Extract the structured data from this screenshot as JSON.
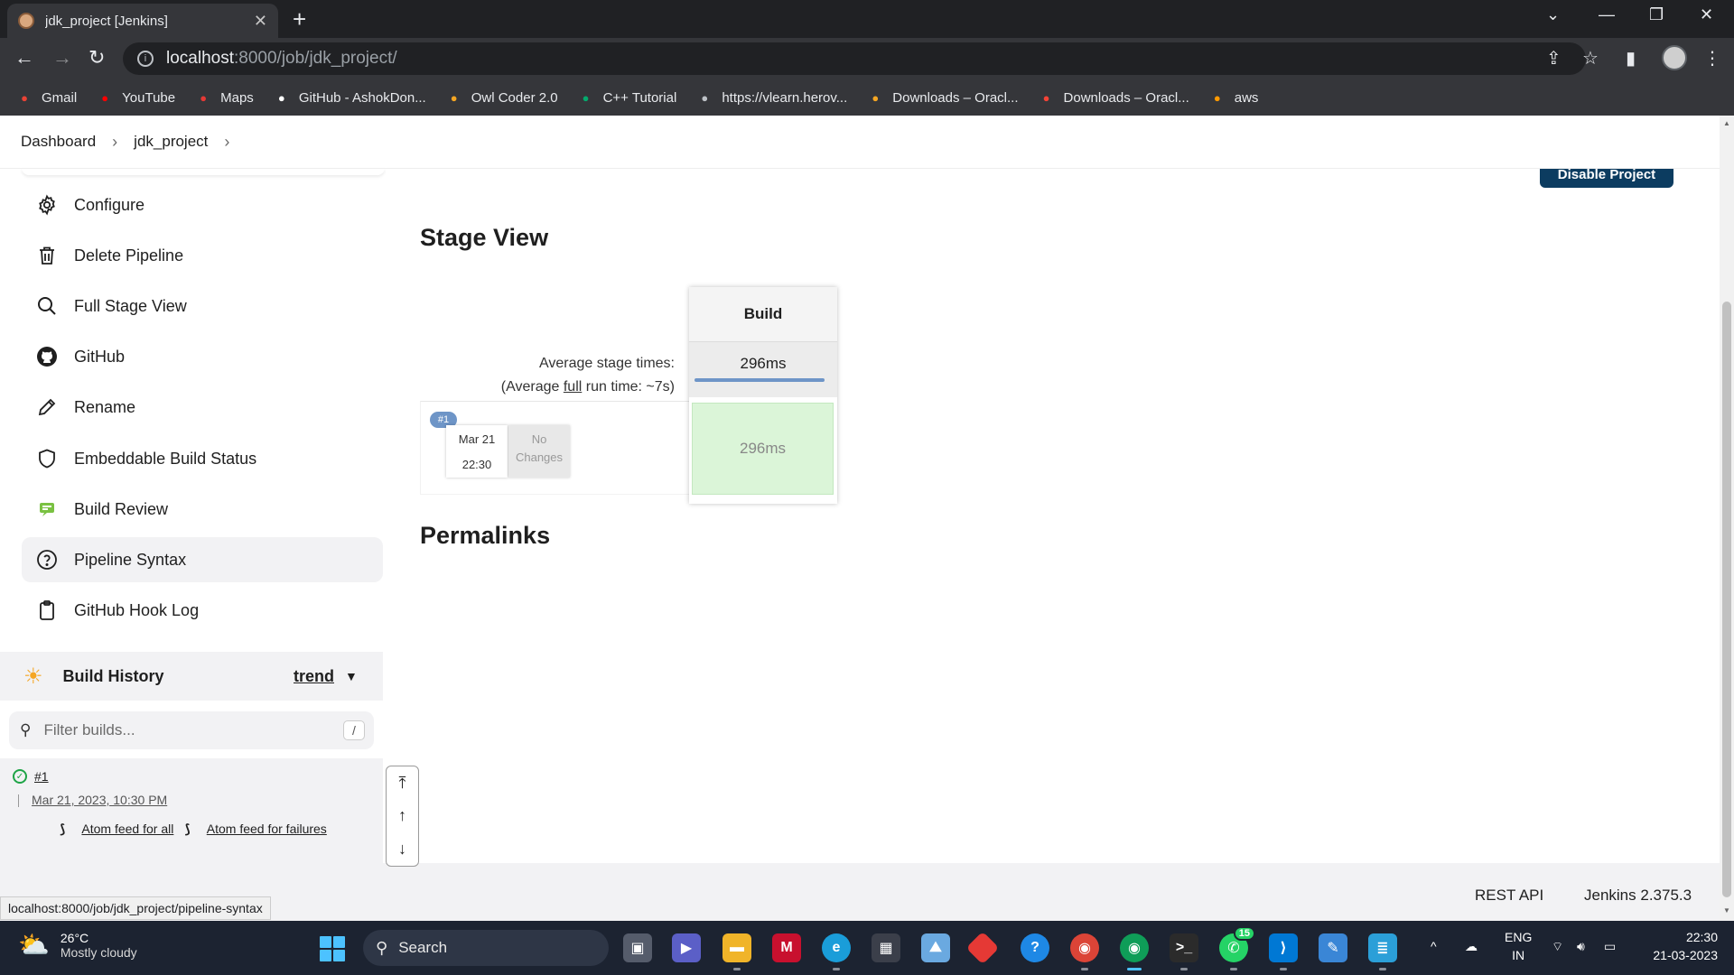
{
  "browser": {
    "tab_title": "jdk_project [Jenkins]",
    "url_host": "localhost",
    "url_path": ":8000/job/jdk_project/",
    "bookmarks": [
      {
        "label": "Gmail",
        "icon": "gmail-icon",
        "color": "#ea4335"
      },
      {
        "label": "YouTube",
        "icon": "youtube-icon",
        "color": "#ff0000"
      },
      {
        "label": "Maps",
        "icon": "maps-icon",
        "color": "#e53935"
      },
      {
        "label": "GitHub - AshokDon...",
        "icon": "github-icon",
        "color": "#ffffff"
      },
      {
        "label": "Owl Coder 2.0",
        "icon": "owl-coder-icon",
        "color": "#f5a623"
      },
      {
        "label": "C++ Tutorial",
        "icon": "w3schools-icon",
        "color": "#04aa6d"
      },
      {
        "label": "https://vlearn.herov...",
        "icon": "globe-icon",
        "color": "#bdc1c6"
      },
      {
        "label": "Downloads – Oracl...",
        "icon": "oracle-java-icon",
        "color": "#f5a623"
      },
      {
        "label": "Downloads – Oracl...",
        "icon": "oracle-arrow-icon",
        "color": "#f44336"
      },
      {
        "label": "aws",
        "icon": "aws-icon",
        "color": "#ff9900"
      }
    ]
  },
  "breadcrumbs": [
    "Dashboard",
    "jdk_project"
  ],
  "actions": {
    "disable_project": "Disable Project"
  },
  "sidebar": {
    "items": [
      {
        "label": "Configure",
        "icon": "gear-icon"
      },
      {
        "label": "Delete Pipeline",
        "icon": "trash-icon"
      },
      {
        "label": "Full Stage View",
        "icon": "search-icon"
      },
      {
        "label": "GitHub",
        "icon": "github-icon"
      },
      {
        "label": "Rename",
        "icon": "pencil-icon"
      },
      {
        "label": "Embeddable Build Status",
        "icon": "shield-icon"
      },
      {
        "label": "Build Review",
        "icon": "build-review-icon"
      },
      {
        "label": "Pipeline Syntax",
        "icon": "help-circle-icon"
      },
      {
        "label": "GitHub Hook Log",
        "icon": "clipboard-icon"
      }
    ],
    "active_index": 7
  },
  "build_history": {
    "title": "Build History",
    "trend": "trend",
    "filter_placeholder": "Filter builds...",
    "shortcut_key": "/",
    "builds": [
      {
        "number": "#1",
        "date": "Mar 21, 2023, 10:30 PM",
        "status": "success"
      }
    ],
    "feed_all": "Atom feed for all",
    "feed_failures": "Atom feed for failures"
  },
  "stage_view": {
    "title": "Stage View",
    "avg_label": "Average stage times:",
    "avg_run_prefix": "(Average ",
    "avg_run_link": "full",
    "avg_run_suffix": " run time: ~7s)",
    "stage_name": "Build",
    "stage_avg": "296ms",
    "run": {
      "badge": "#1",
      "date": "Mar 21",
      "time": "22:30",
      "changes_line1": "No",
      "changes_line2": "Changes",
      "cell": "296ms"
    }
  },
  "permalinks": {
    "title": "Permalinks"
  },
  "footer": {
    "rest_api": "REST API",
    "version": "Jenkins 2.375.3"
  },
  "status_url": "localhost:8000/job/jdk_project/pipeline-syntax",
  "taskbar": {
    "temperature": "26°C",
    "weather": "Mostly cloudy",
    "search": "Search",
    "lang1": "ENG",
    "lang2": "IN",
    "time": "22:30",
    "date": "21-03-2023",
    "whatsapp_badge": "15"
  }
}
